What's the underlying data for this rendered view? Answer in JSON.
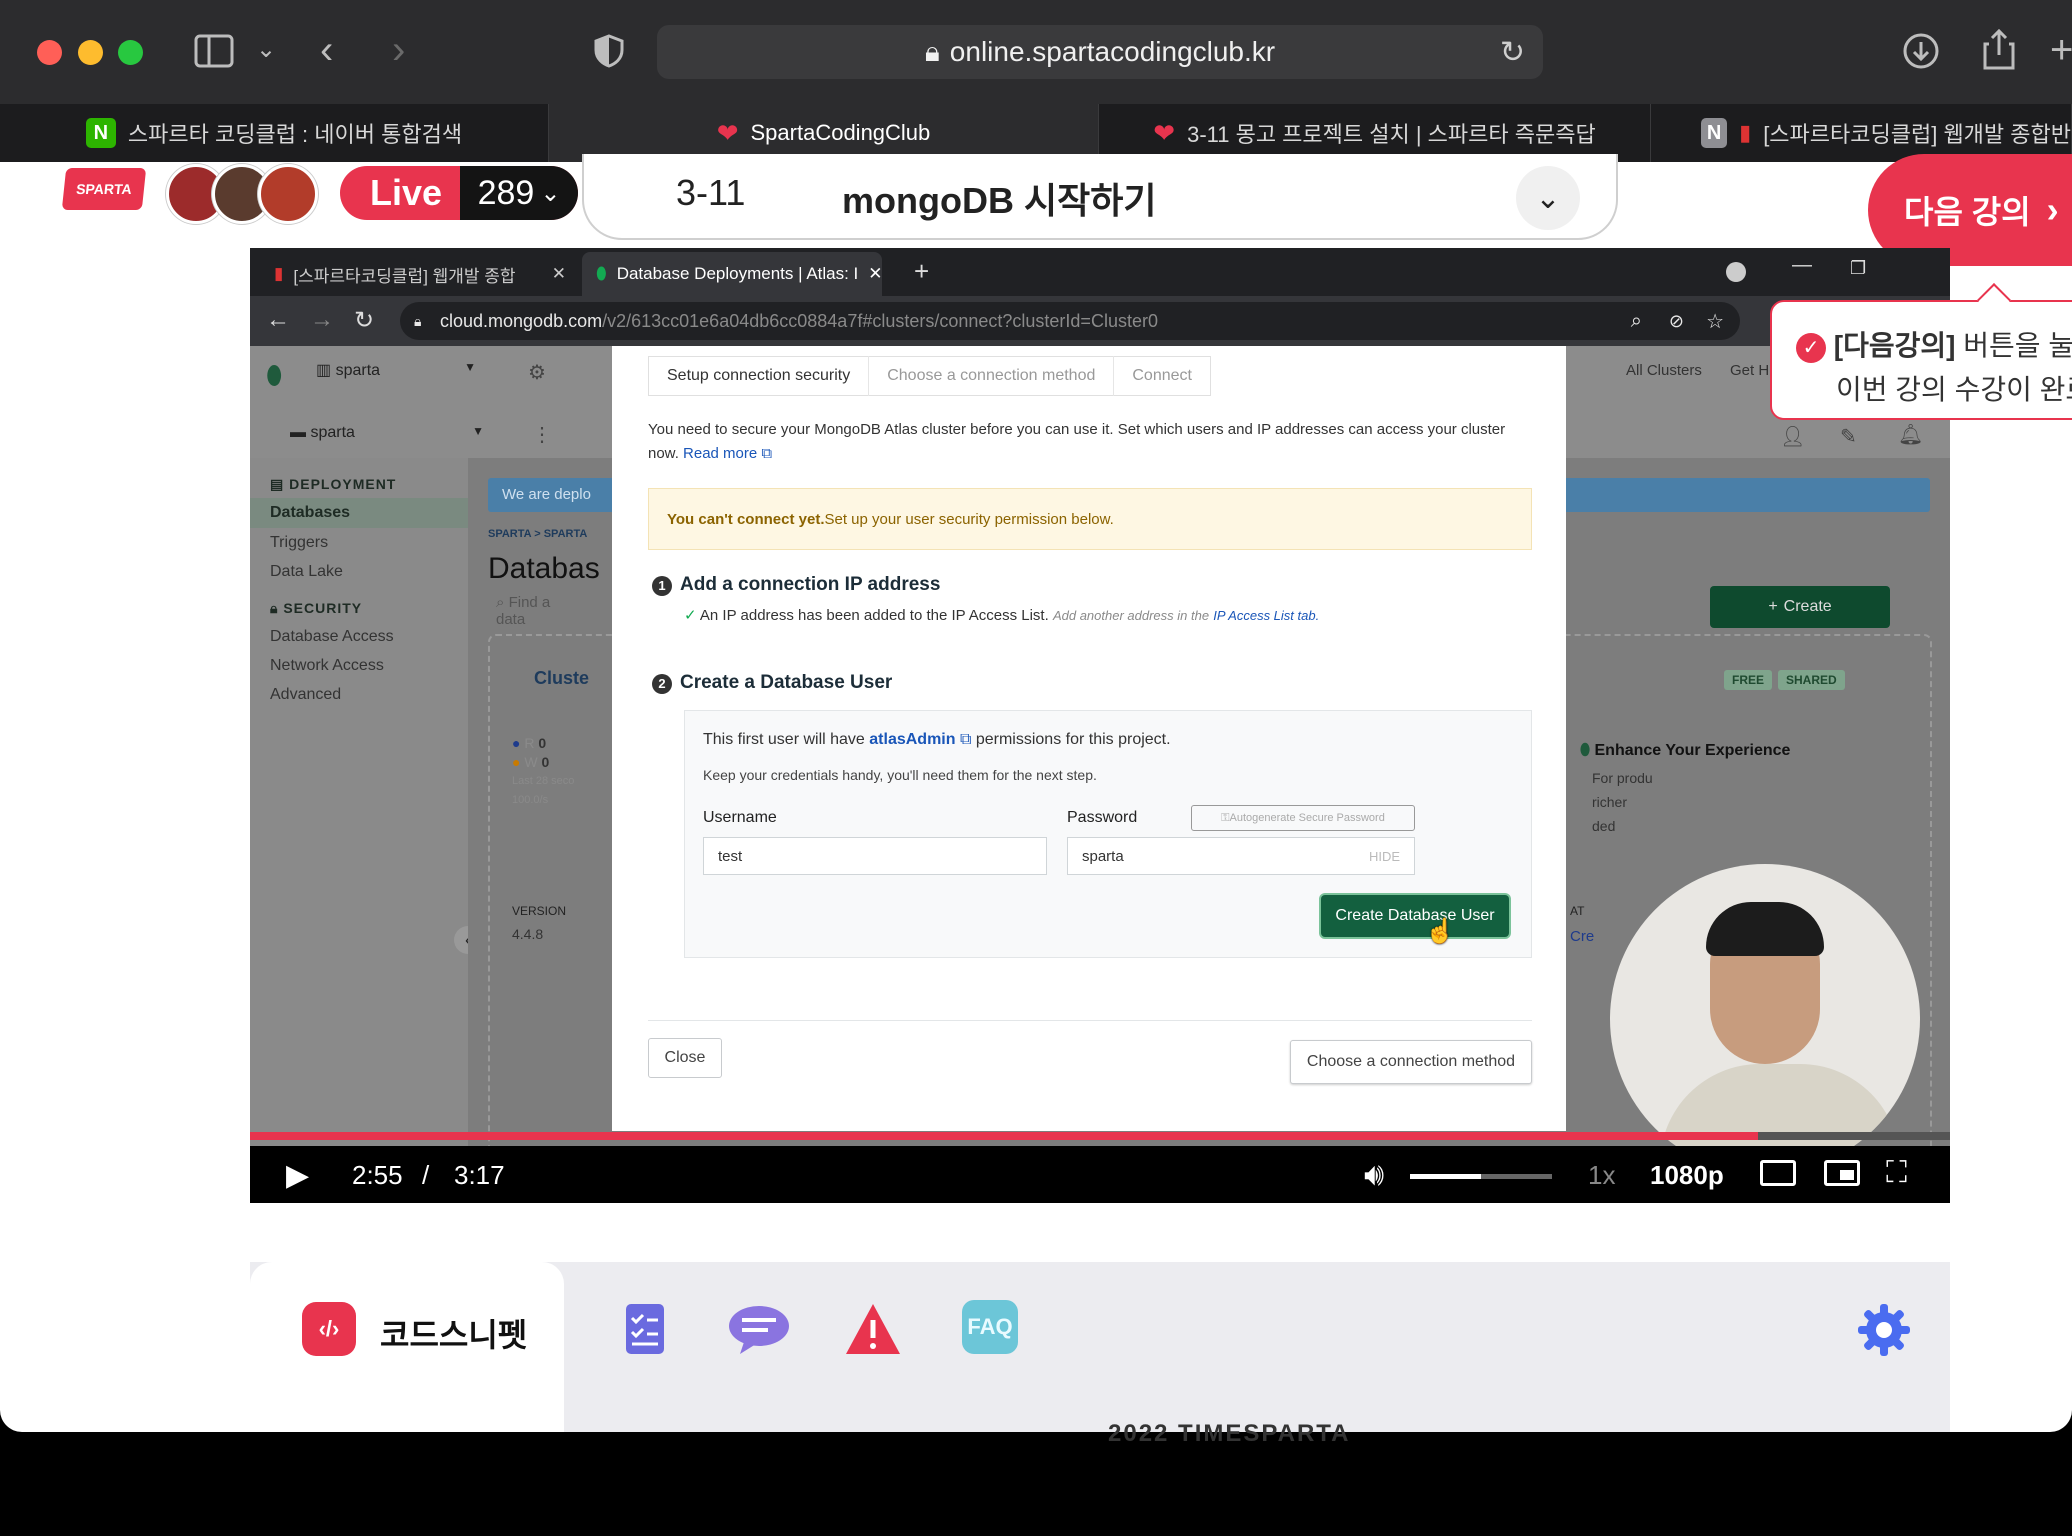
{
  "safari": {
    "url": "online.spartacodingclub.kr",
    "tabs": [
      {
        "label": "스파르타 코딩클럽 : 네이버 통합검색",
        "favicon": "N"
      },
      {
        "label": "SpartaCodingClub",
        "favicon": "heart"
      },
      {
        "label": "3-11 몽고 프로젝트 설치 | 스파르타 즉문즉답",
        "favicon": "heart"
      },
      {
        "label": "[스파르타코딩클럽] 웹개발 종합반",
        "favicon": "N"
      }
    ]
  },
  "header": {
    "logo": "SPARTA",
    "live_label": "Live",
    "live_count": "289",
    "lecture_number": "3-11",
    "lecture_title": "mongoDB 시작하기",
    "next_button": "다음 강의"
  },
  "tooltip": {
    "bold": "[다음강의]",
    "line1_rest": " 버튼을 눌",
    "line2": "이번 강의 수강이 완료"
  },
  "video": {
    "chrome": {
      "tabs": [
        {
          "label": "[스파르타코딩클럽] 웹개발 종합"
        },
        {
          "label": "Database Deployments | Atlas: I"
        }
      ],
      "url_host": "cloud.mongodb.com",
      "url_path": "/v2/613cc01e6a04db6cc0884a7f#clusters/connect?clusterId=Cluster0"
    },
    "atlas": {
      "org": "sparta",
      "project": "sparta",
      "top_right": [
        "All Clusters",
        "Get H"
      ],
      "sidebar": {
        "deployment_head": "DEPLOYMENT",
        "deployment_items": [
          "Databases",
          "Triggers",
          "Data Lake"
        ],
        "security_head": "SECURITY",
        "security_items": [
          "Database Access",
          "Network Access",
          "Advanced"
        ]
      },
      "banner": "We are deplo",
      "breadcrumb": "SPARTA > SPARTA",
      "page_title": "Databas",
      "find_placeholder": "Find a data",
      "create_button": "Create",
      "cluster_name": "Cluste",
      "badges": [
        "FREE",
        "SHARED"
      ],
      "metrics": {
        "r": "R",
        "r_val": "0",
        "w": "W",
        "w_val": "0",
        "last": "Last 28 seco",
        "rate": "100.0/s"
      },
      "version_label": "VERSION",
      "version_value": "4.4.8",
      "enhance_title": "Enhance Your Experience",
      "enhance_lines": [
        "For produ",
        "richer",
        "ded"
      ],
      "at_label": "AT",
      "cre_label": "Cre"
    },
    "modal": {
      "steps": [
        "Setup connection security",
        "Choose a connection method",
        "Connect"
      ],
      "intro": "You need to secure your MongoDB Atlas cluster before you can use it. Set which users and IP addresses can access your cluster now.",
      "read_more": "Read more",
      "warn_bold": "You can't connect yet.",
      "warn_rest": " Set up your user security permission below.",
      "step1_title": "Add a connection IP address",
      "step1_desc": "An IP address has been added to the IP Access List.",
      "step1_hint": "Add another address in the",
      "step1_link": "IP Access List tab.",
      "step2_title": "Create a Database User",
      "user_note_pre": "This first user will have ",
      "user_note_link": "atlasAdmin",
      "user_note_post": " permissions for this project.",
      "user_note2": "Keep your credentials handy, you'll need them for the next step.",
      "username_label": "Username",
      "username_value": "test",
      "password_label": "Password",
      "password_value": "sparta",
      "autogen": "Autogenerate Secure Password",
      "hide": "HIDE",
      "create_user_button": "Create Database User",
      "close_button": "Close",
      "choose_button": "Choose a connection method"
    },
    "player": {
      "current_time": "2:55",
      "separator": "/",
      "duration": "3:17",
      "speed": "1x",
      "quality": "1080p",
      "progress": 0.887,
      "volume": 0.5
    }
  },
  "dock": {
    "active_tab": "코드스니펫",
    "tab_icons": [
      "checklist-icon",
      "chat-icon",
      "warning-icon",
      "faq-icon"
    ],
    "faq_label": "FAQ",
    "footer_fragment": "2022 TIMESPARTA"
  },
  "colors": {
    "brand": "#e8344e",
    "atlas_green": "#13603f"
  }
}
